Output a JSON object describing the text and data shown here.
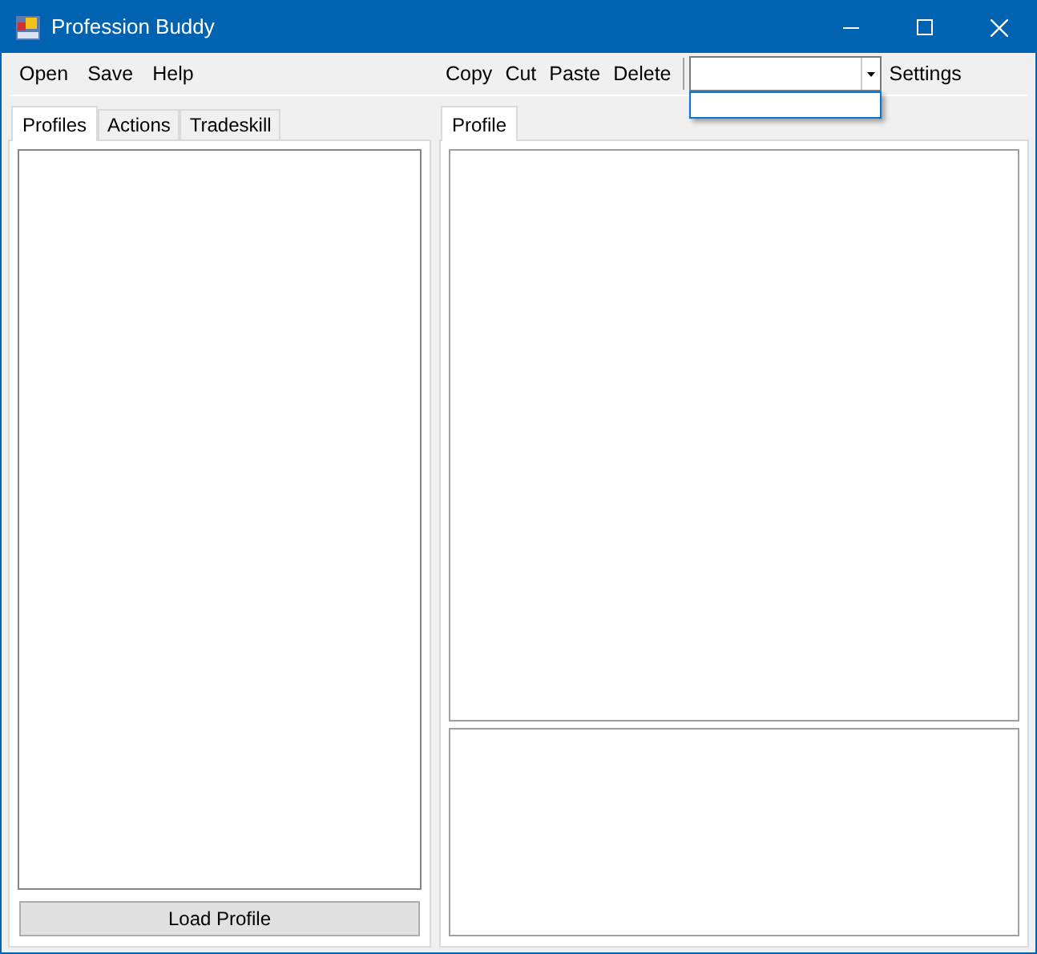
{
  "window": {
    "title": "Profession Buddy"
  },
  "menu": [
    {
      "label": "Open"
    },
    {
      "label": "Save"
    },
    {
      "label": "Help"
    }
  ],
  "toolbar": [
    {
      "label": "Copy"
    },
    {
      "label": "Cut"
    },
    {
      "label": "Paste"
    },
    {
      "label": "Delete"
    }
  ],
  "profile_combo": {
    "expanded": true
  },
  "settings": "Settings",
  "left_tabs": [
    {
      "label": "Profiles",
      "selected": true
    },
    {
      "label": "Actions",
      "selected": false
    },
    {
      "label": "Tradeskill",
      "selected": false
    }
  ],
  "load_button": "Load Profile",
  "right_tabs": [
    {
      "label": "Profile",
      "selected": true
    }
  ]
}
